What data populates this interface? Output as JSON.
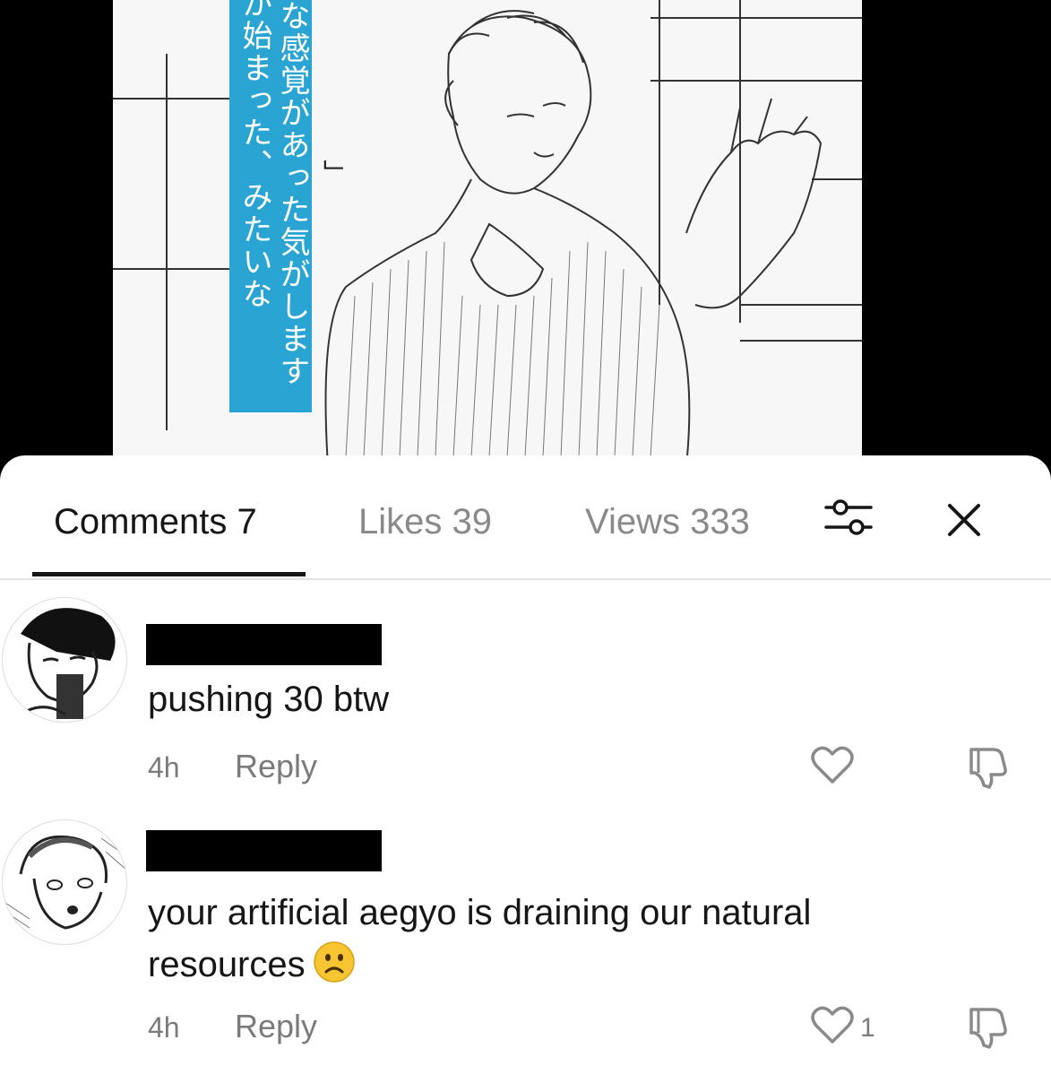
{
  "image_caption": {
    "columns": [
      "が始まった、みたいな",
      "な感覚があった気がします",
      "」"
    ]
  },
  "tabs": [
    {
      "label": "Comments 7",
      "active": true
    },
    {
      "label": "Likes 39",
      "active": false
    },
    {
      "label": "Views 333",
      "active": false
    }
  ],
  "toolbar": {
    "filter_icon": "filter-sliders-icon",
    "close_icon": "close-icon"
  },
  "comments": [
    {
      "username_redacted": true,
      "text": "pushing 30 btw",
      "time": "4h",
      "reply_label": "Reply",
      "like_count": "",
      "icons": {
        "like": "heart-icon",
        "dislike": "thumbs-down-icon"
      }
    },
    {
      "username_redacted": true,
      "text_line1": "your artificial aegyo is draining our natural",
      "text_line2": "resources",
      "emoji": "frowning-face-emoji",
      "time": "4h",
      "reply_label": "Reply",
      "like_count": "1",
      "icons": {
        "like": "heart-icon",
        "dislike": "thumbs-down-icon"
      }
    }
  ],
  "colors": {
    "caption_blue": "#2aa4d2",
    "text_dark": "#161616",
    "text_muted": "#7b7b7b"
  }
}
